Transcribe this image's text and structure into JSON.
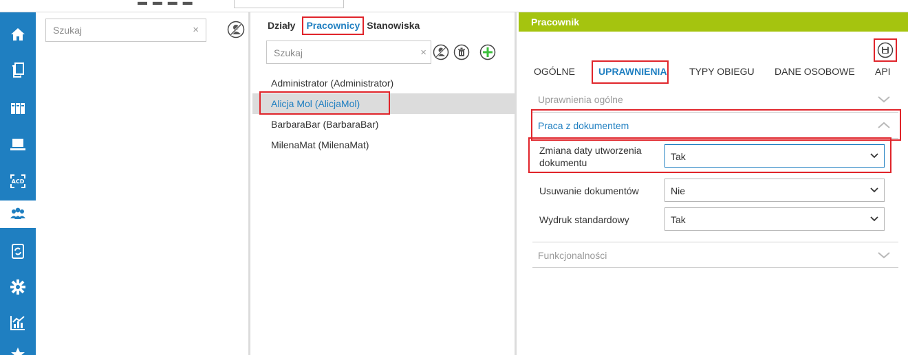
{
  "panel1": {
    "search_placeholder": "Szukaj",
    "clear_glyph": "×"
  },
  "panel2": {
    "tabs": [
      {
        "label": "Działy",
        "active": false
      },
      {
        "label": "Pracownicy",
        "active": true
      },
      {
        "label": "Stanowiska",
        "active": false
      }
    ],
    "search_placeholder": "Szukaj",
    "clear_glyph": "×",
    "employees": [
      {
        "label": "Administrator (Administrator)",
        "selected": false
      },
      {
        "label": "Alicja Mol (AlicjaMol)",
        "selected": true
      },
      {
        "label": "BarbaraBar (BarbaraBar)",
        "selected": false
      },
      {
        "label": "MilenaMat (MilenaMat)",
        "selected": false
      }
    ]
  },
  "panel3": {
    "title": "Pracownik",
    "tabs": [
      {
        "label": "OGÓLNE",
        "active": false
      },
      {
        "label": "UPRAWNIENIA",
        "active": true
      },
      {
        "label": "TYPY OBIEGU",
        "active": false
      },
      {
        "label": "DANE OSOBOWE",
        "active": false
      },
      {
        "label": "API",
        "active": false
      }
    ],
    "sections": {
      "general": "Uprawnienia ogólne",
      "documents": "Praca z dokumentem",
      "features": "Funkcjonalności"
    },
    "fields": [
      {
        "label": "Zmiana daty utworzenia dokumentu",
        "value": "Tak"
      },
      {
        "label": "Usuwanie dokumentów",
        "value": "Nie"
      },
      {
        "label": "Wydruk standardowy",
        "value": "Tak"
      }
    ]
  },
  "colors": {
    "accent": "#1f7fc1",
    "header_green": "#a5c40f",
    "highlight_red": "#e0242a"
  }
}
